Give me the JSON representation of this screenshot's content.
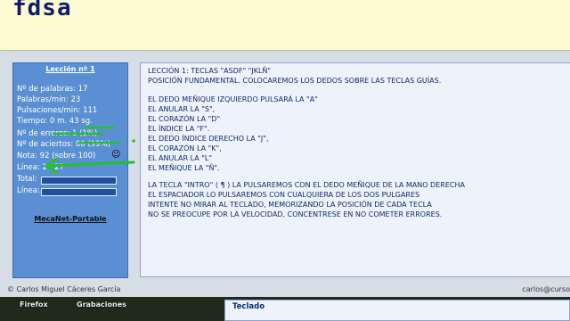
{
  "typing": {
    "text": "fdsa"
  },
  "stats": {
    "lesson": "Lección nº 1",
    "words": "Nº de palabras: 17",
    "words_per_min": "Palabras/min: 23",
    "keys_per_min": "Pulsaciones/min: 111",
    "time": "Tiempo: 0 m. 43 sg.",
    "errors": "Nº de errores: 1 (1%)",
    "hits": "Nº de aciertos: 80 (99%)",
    "grade": "Nota: 92 (sobre 100)",
    "line": "Línea: 2 / 27",
    "total_label": "Total:",
    "line_label": "Línea:",
    "app_name": "MecaNet-Portable"
  },
  "lesson_text": {
    "l1": "LECCIÓN 1: TECLAS \"ASDF\"  \"JKLÑ\"",
    "l2": "POSICIÓN FUNDAMENTAL. COLOCAREMOS LOS DEDOS SOBRE LAS TECLAS GUÍAS.",
    "l3": "EL DEDO MEÑIQUE IZQUIERDO PULSARÁ LA  \"A\"",
    "l4": "EL ANULAR LA \"S\",",
    "l5": "EL CORAZÓN LA \"D\"",
    "l6": "EL ÍNDICE LA \"F\".",
    "l7": "EL DEDO ÍNDICE DERECHO LA \"J\",",
    "l8": "EL CORAZÓN LA \"K\",",
    "l9": "EL ANULAR LA \"L\"",
    "l10": "EL MEÑIQUE LA \"Ñ\".",
    "l11": "LA TECLA \"INTRO\" ( ¶ ) LA PULSAREMOS CON EL DEDO MEÑIQUE DE LA MANO DERECHA",
    "l12": "EL ESPACIADOR LO PULSAREMOS CON CUALQUIERA DE LOS DOS PULGARES",
    "l13": "INTENTE NO MIRAR AL TECLADO, MEMORIZANDO LA POSICIÓN DE CADA TECLA",
    "l14": "NO SE PREOCUPE POR LA VELOCIDAD, CONCENTRESE EN NO COMETER ERRORES."
  },
  "footer": {
    "author": "© Carlos Miguel Cáceres García",
    "email": "carlos@curso"
  },
  "taskbar": {
    "firefox": "Firefox",
    "recordings": "Grabaciones",
    "keyboard": "Teclado"
  },
  "colors": {
    "panel": "#5b8fd3",
    "typing_bg": "#fbfbd2",
    "annotation": "#22c22a"
  }
}
